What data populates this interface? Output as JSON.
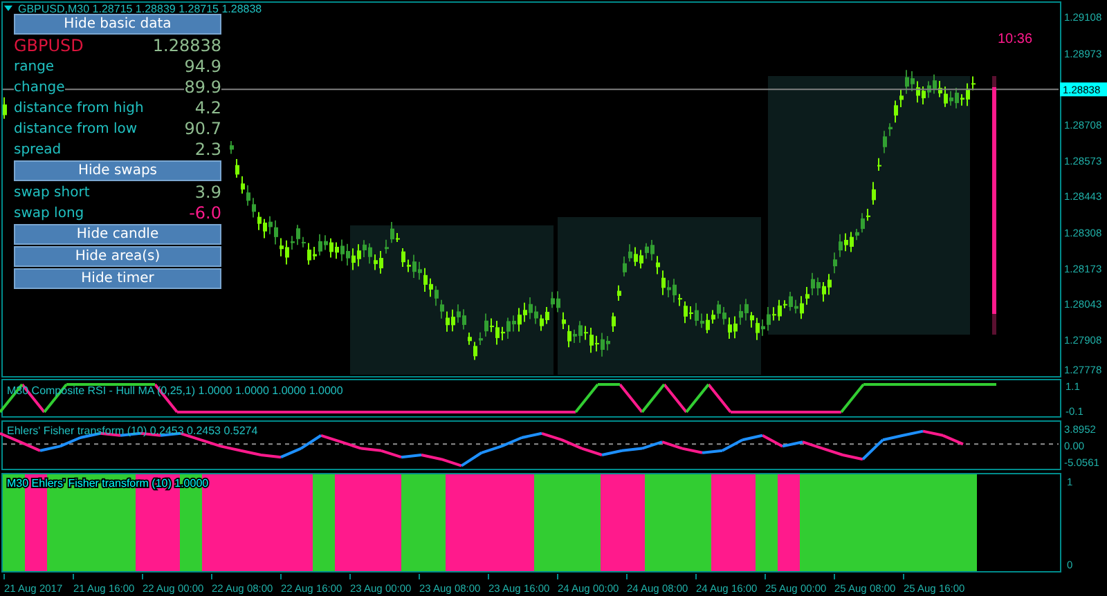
{
  "chart_header": {
    "title": "GBPUSD,M30  1.28715 1.28839 1.28715 1.28838"
  },
  "info_panel": {
    "items": [
      {
        "kind": "button",
        "label": "Hide basic data"
      },
      {
        "kind": "symbol",
        "label": "GBPUSD",
        "value": "1.28838",
        "color": "#8fbc8f"
      },
      {
        "kind": "row",
        "label": "range",
        "value": "94.9",
        "color": "#8fbc8f"
      },
      {
        "kind": "row",
        "label": "change",
        "value": "89.9",
        "color": "#8fbc8f"
      },
      {
        "kind": "row",
        "label": "distance from high",
        "value": "4.2",
        "color": "#8fbc8f"
      },
      {
        "kind": "row",
        "label": "distance from low",
        "value": "90.7",
        "color": "#8fbc8f"
      },
      {
        "kind": "row",
        "label": "spread",
        "value": "2.3",
        "color": "#8fbc8f"
      },
      {
        "kind": "button",
        "label": "Hide swaps"
      },
      {
        "kind": "row",
        "label": "swap short",
        "value": "3.9",
        "color": "#8fbc8f"
      },
      {
        "kind": "row",
        "label": "swap long",
        "value": "-6.0",
        "color": "#ff1a8c"
      },
      {
        "kind": "button",
        "label": "Hide candle"
      },
      {
        "kind": "button",
        "label": "Hide area(s)"
      },
      {
        "kind": "button",
        "label": "Hide timer"
      }
    ]
  },
  "price_chart": {
    "current_price": "1.28838",
    "timer": "10:36",
    "price_ticks": [
      "1.29108",
      "1.28973",
      "1.28708",
      "1.28573",
      "1.28443",
      "1.28308",
      "1.28173",
      "1.28043",
      "1.27908",
      "1.27778"
    ]
  },
  "rsi_panel": {
    "title": "M30 Composite RSI - Hull MA (0,25,1) 1.0000 1.0000 1.0000 1.0000",
    "ticks": [
      "1.1",
      "-0.1"
    ]
  },
  "fisher_panel": {
    "title": "Ehlers' Fisher transform (10) 0.2453 0.2453 0.5274",
    "ticks": [
      "3.8952",
      "0.00",
      "-5.0561"
    ]
  },
  "fisher_histogram": {
    "title": "M30 Ehlers' Fisher transform (10) 1.0000",
    "ticks": [
      "1",
      "0"
    ],
    "bars": [
      {
        "color": "#32cd32"
      },
      {
        "color": "#ff1a8c"
      },
      {
        "color": "#32cd32"
      },
      {
        "color": "#32cd32"
      },
      {
        "color": "#32cd32"
      },
      {
        "color": "#32cd32"
      },
      {
        "color": "#ff1a8c"
      },
      {
        "color": "#ff1a8c"
      },
      {
        "color": "#32cd32"
      },
      {
        "color": "#ff1a8c"
      },
      {
        "color": "#ff1a8c"
      },
      {
        "color": "#ff1a8c"
      },
      {
        "color": "#ff1a8c"
      },
      {
        "color": "#ff1a8c"
      },
      {
        "color": "#32cd32"
      },
      {
        "color": "#ff1a8c"
      },
      {
        "color": "#ff1a8c"
      },
      {
        "color": "#ff1a8c"
      },
      {
        "color": "#32cd32"
      },
      {
        "color": "#32cd32"
      },
      {
        "color": "#ff1a8c"
      },
      {
        "color": "#ff1a8c"
      },
      {
        "color": "#ff1a8c"
      },
      {
        "color": "#ff1a8c"
      },
      {
        "color": "#32cd32"
      },
      {
        "color": "#32cd32"
      },
      {
        "color": "#32cd32"
      },
      {
        "color": "#ff1a8c"
      },
      {
        "color": "#ff1a8c"
      },
      {
        "color": "#32cd32"
      },
      {
        "color": "#32cd32"
      },
      {
        "color": "#32cd32"
      },
      {
        "color": "#ff1a8c"
      },
      {
        "color": "#ff1a8c"
      },
      {
        "color": "#32cd32"
      },
      {
        "color": "#ff1a8c"
      },
      {
        "color": "#32cd32"
      },
      {
        "color": "#32cd32"
      },
      {
        "color": "#32cd32"
      },
      {
        "color": "#32cd32"
      },
      {
        "color": "#32cd32"
      },
      {
        "color": "#32cd32"
      },
      {
        "color": "#32cd32"
      },
      {
        "color": "#32cd32"
      }
    ]
  },
  "time_axis": {
    "labels": [
      "21 Aug 2017",
      "21 Aug 16:00",
      "22 Aug 00:00",
      "22 Aug 08:00",
      "22 Aug 16:00",
      "23 Aug 00:00",
      "23 Aug 08:00",
      "23 Aug 16:00",
      "24 Aug 00:00",
      "24 Aug 08:00",
      "24 Aug 16:00",
      "25 Aug 00:00",
      "25 Aug 08:00",
      "25 Aug 16:00"
    ]
  }
}
